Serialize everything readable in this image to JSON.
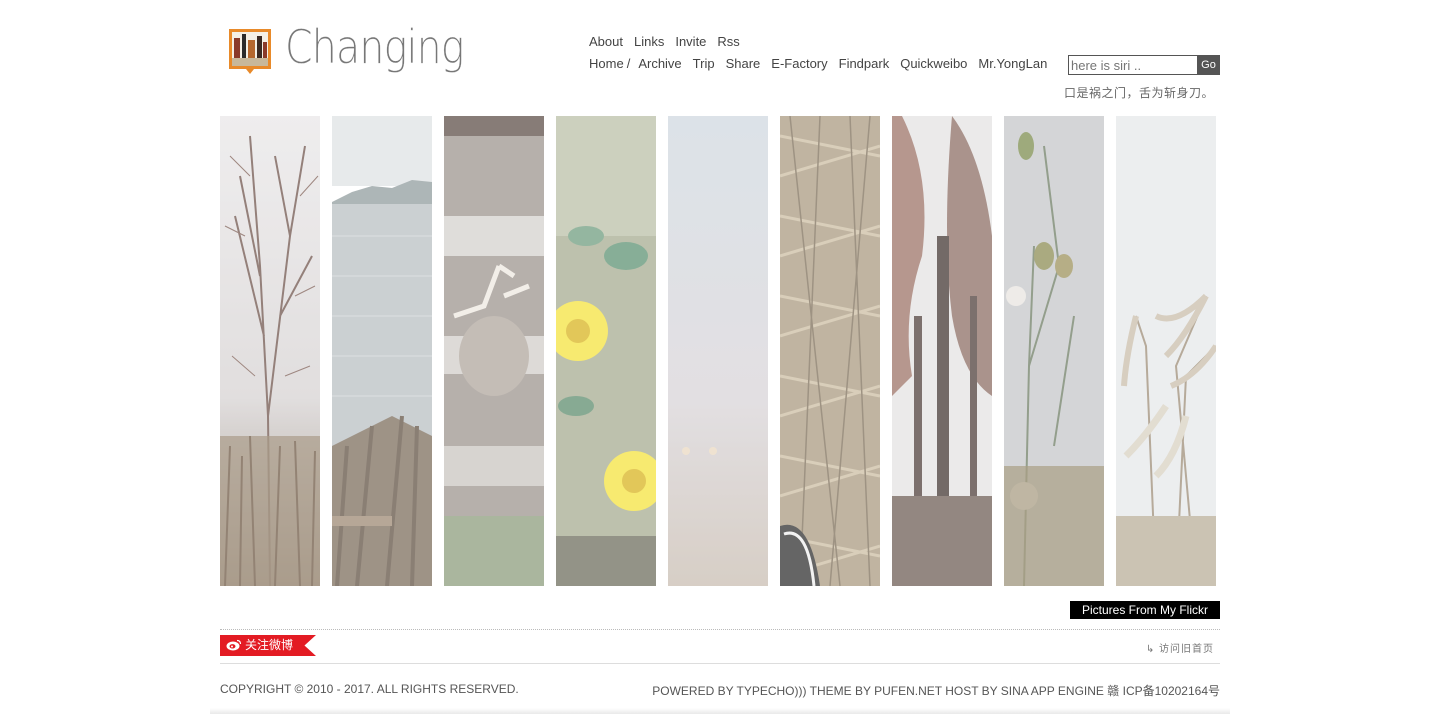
{
  "header": {
    "title": "Changing",
    "nav_top": [
      "About",
      "Links",
      "Invite",
      "Rss"
    ],
    "nav_main": [
      "Home",
      "Archive",
      "Trip",
      "Share",
      "E-Factory",
      "Findpark",
      "Quickweibo",
      "Mr.YongLan"
    ],
    "home_separator": "/",
    "search_placeholder": "here is siri ..",
    "search_button": "Go",
    "motto": "口是祸之门，舌为斩身刀。"
  },
  "gallery": {
    "strips": [
      "branches",
      "lake",
      "deer",
      "yellow-flowers",
      "misty-sky",
      "dry-grass",
      "tall-trees",
      "wild-buds",
      "pampas-grass"
    ],
    "flickr_label": "Pictures From My Flickr"
  },
  "footer": {
    "weibo_label": "关注微博",
    "old_home_label": "↳ 访问旧首页",
    "copyright": "COPYRIGHT © 2010 - 2017. ALL RIGHTS RESERVED.",
    "powered": "POWERED BY TYPECHO))) THEME BY PUFEN.NET HOST BY SINA APP ENGINE 赣 ICP备10202164号"
  },
  "colors": {
    "accent_red": "#e31b23",
    "dark": "#000000",
    "logo_orange": "#e88a2a"
  }
}
